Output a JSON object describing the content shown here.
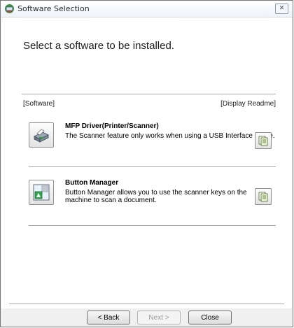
{
  "window": {
    "title": "Software Selection",
    "close_symbol": "✕"
  },
  "heading": "Select a software to be installed.",
  "columns": {
    "left": "[Software]",
    "right": "[Display Readme]"
  },
  "software": [
    {
      "title": "MFP Driver(Printer/Scanner)",
      "description": "The Scanner feature only works when using a USB Interface Cable.",
      "icon": "printer-scanner-icon"
    },
    {
      "title": "Button Manager",
      "description": "Button Manager allows you to use the scanner keys on the machine to scan a document.",
      "icon": "button-manager-icon"
    }
  ],
  "buttons": {
    "back": "< Back",
    "next": "Next >",
    "close": "Close"
  }
}
